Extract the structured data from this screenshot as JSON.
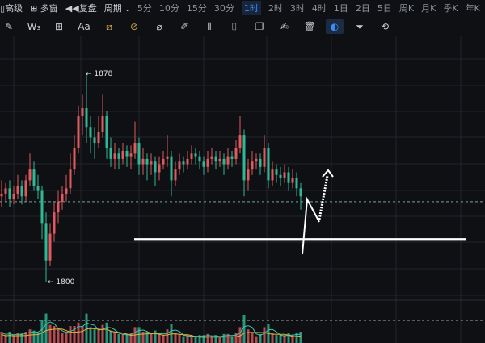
{
  "toolbar": {
    "items": [
      "高级",
      "多窗",
      "复盘",
      "周期"
    ],
    "periods": [
      "5分",
      "10分",
      "15分",
      "30分",
      "1时",
      "2时",
      "3时",
      "4时",
      "1日",
      "2日",
      "5日",
      "周K",
      "月K",
      "季K",
      "年K"
    ],
    "active_period": "1时",
    "text_tool": "Aa"
  },
  "colors": {
    "up": "#e05a5f",
    "down": "#2fb896",
    "accent": "#3d8df5",
    "grid": "#22252b"
  },
  "chart_data": {
    "type": "candlestick",
    "high_label": "← 1878",
    "low_label": "← 1800",
    "current_price_ref": 1830,
    "support_line": 1816,
    "candles": [
      [
        1832,
        1838,
        1828,
        1833
      ],
      [
        1833,
        1837,
        1830,
        1835
      ],
      [
        1835,
        1838,
        1828,
        1831
      ],
      [
        1831,
        1836,
        1829,
        1833
      ],
      [
        1833,
        1840,
        1831,
        1836
      ],
      [
        1836,
        1838,
        1829,
        1832
      ],
      [
        1832,
        1840,
        1830,
        1838
      ],
      [
        1838,
        1848,
        1836,
        1842
      ],
      [
        1842,
        1845,
        1834,
        1836
      ],
      [
        1836,
        1840,
        1831,
        1834
      ],
      [
        1834,
        1836,
        1816,
        1822
      ],
      [
        1822,
        1826,
        1800,
        1808
      ],
      [
        1808,
        1822,
        1806,
        1818
      ],
      [
        1818,
        1830,
        1815,
        1826
      ],
      [
        1826,
        1834,
        1822,
        1830
      ],
      [
        1830,
        1836,
        1827,
        1833
      ],
      [
        1833,
        1840,
        1830,
        1835
      ],
      [
        1835,
        1848,
        1833,
        1842
      ],
      [
        1842,
        1855,
        1840,
        1850
      ],
      [
        1850,
        1866,
        1848,
        1862
      ],
      [
        1862,
        1870,
        1855,
        1865
      ],
      [
        1865,
        1878,
        1852,
        1858
      ],
      [
        1858,
        1862,
        1848,
        1854
      ],
      [
        1854,
        1858,
        1846,
        1852
      ],
      [
        1852,
        1862,
        1850,
        1856
      ],
      [
        1856,
        1870,
        1854,
        1862
      ],
      [
        1862,
        1864,
        1846,
        1850
      ],
      [
        1850,
        1854,
        1843,
        1846
      ],
      [
        1846,
        1852,
        1842,
        1848
      ],
      [
        1848,
        1850,
        1842,
        1846
      ],
      [
        1846,
        1852,
        1844,
        1849
      ],
      [
        1849,
        1851,
        1843,
        1847
      ],
      [
        1847,
        1851,
        1842,
        1848
      ],
      [
        1848,
        1860,
        1846,
        1852
      ],
      [
        1852,
        1854,
        1840,
        1844
      ],
      [
        1844,
        1850,
        1840,
        1846
      ],
      [
        1846,
        1848,
        1838,
        1844
      ],
      [
        1844,
        1848,
        1840,
        1845
      ],
      [
        1845,
        1847,
        1836,
        1841
      ],
      [
        1841,
        1847,
        1838,
        1844
      ],
      [
        1844,
        1849,
        1842,
        1846
      ],
      [
        1846,
        1855,
        1843,
        1847
      ],
      [
        1847,
        1849,
        1832,
        1838
      ],
      [
        1838,
        1845,
        1836,
        1842
      ],
      [
        1842,
        1848,
        1840,
        1845
      ],
      [
        1845,
        1847,
        1841,
        1844
      ],
      [
        1844,
        1849,
        1842,
        1846
      ],
      [
        1846,
        1851,
        1844,
        1848
      ],
      [
        1848,
        1850,
        1844,
        1847
      ],
      [
        1847,
        1849,
        1842,
        1845
      ],
      [
        1845,
        1847,
        1840,
        1843
      ],
      [
        1843,
        1849,
        1841,
        1846
      ],
      [
        1846,
        1850,
        1844,
        1847
      ],
      [
        1847,
        1849,
        1842,
        1845
      ],
      [
        1845,
        1849,
        1843,
        1846
      ],
      [
        1846,
        1848,
        1840,
        1844
      ],
      [
        1844,
        1850,
        1842,
        1847
      ],
      [
        1847,
        1849,
        1843,
        1846
      ],
      [
        1846,
        1853,
        1844,
        1850
      ],
      [
        1850,
        1862,
        1848,
        1855
      ],
      [
        1855,
        1857,
        1832,
        1838
      ],
      [
        1838,
        1846,
        1834,
        1842
      ],
      [
        1842,
        1849,
        1840,
        1845
      ],
      [
        1845,
        1848,
        1842,
        1846
      ],
      [
        1846,
        1848,
        1840,
        1843
      ],
      [
        1843,
        1855,
        1841,
        1850
      ],
      [
        1850,
        1852,
        1835,
        1838
      ],
      [
        1838,
        1845,
        1836,
        1842
      ],
      [
        1842,
        1844,
        1837,
        1840
      ],
      [
        1840,
        1843,
        1836,
        1839
      ],
      [
        1839,
        1844,
        1837,
        1841
      ],
      [
        1841,
        1843,
        1834,
        1837
      ],
      [
        1837,
        1842,
        1835,
        1839
      ],
      [
        1839,
        1841,
        1832,
        1835
      ],
      [
        1835,
        1837,
        1827,
        1832
      ]
    ]
  }
}
